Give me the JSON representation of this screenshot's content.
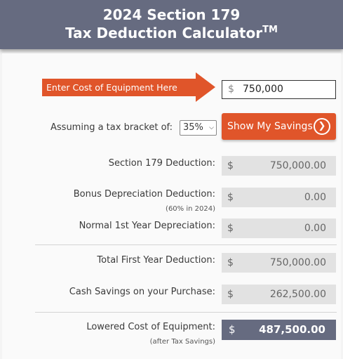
{
  "header": {
    "line1": "2024 Section 179",
    "line2": "Tax Deduction Calculator",
    "trademark": "TM"
  },
  "input": {
    "arrow_label": "Enter Cost of Equipment Here",
    "currency": "$",
    "cost_value": "750,000"
  },
  "bracket": {
    "label": "Assuming a tax bracket of:",
    "selected": "35%"
  },
  "button": {
    "label": "Show My Savings",
    "icon": "chevron-right-circle"
  },
  "results": {
    "currency": "$",
    "section179": {
      "label": "Section 179 Deduction:",
      "value": "$750,000.00"
    },
    "bonus": {
      "label": "Bonus Depreciation Deduction:",
      "note": "(60% in 2024)",
      "value": "$0.00"
    },
    "normal": {
      "label": "Normal 1st Year Depreciation:",
      "value": "$0.00"
    },
    "total": {
      "label": "Total First Year Deduction:",
      "value": "$750,000.00"
    },
    "cash": {
      "label": "Cash Savings on your Purchase:",
      "value": "$262,500.00"
    },
    "lowered": {
      "label": "Lowered Cost of Equipment:",
      "note": "(after Tax Savings)",
      "value": "$487,500.00"
    }
  },
  "colors": {
    "header_bg": "#666b80",
    "accent": "#e0552a",
    "field_bg": "#e2e2e2"
  }
}
